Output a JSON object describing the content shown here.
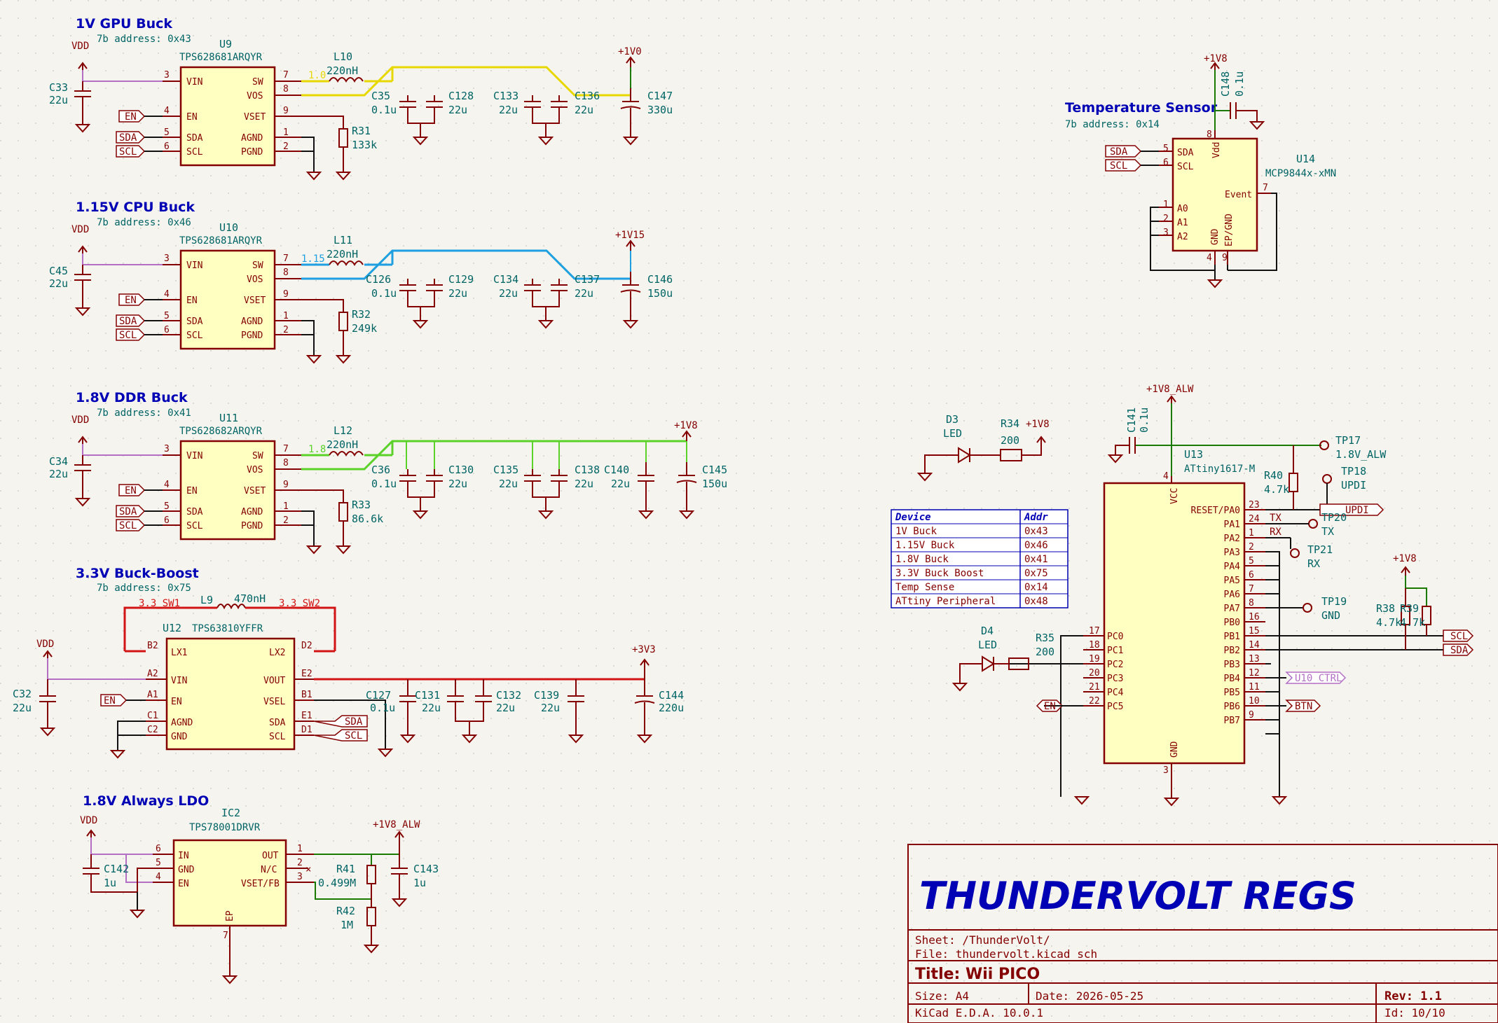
{
  "sections": {
    "gpu": {
      "title": "1V GPU Buck",
      "addr": "7b address: 0x43",
      "ic_ref": "U9",
      "ic_part": "TPS628681ARQYR",
      "inductor": "L10",
      "inductor_val": "220nH",
      "out_rail": "+1V0",
      "vsw_label": "1.0"
    },
    "cpu": {
      "title": "1.15V CPU Buck",
      "addr": "7b address: 0x46",
      "ic_ref": "U10",
      "ic_part": "TPS628681ARQYR",
      "inductor": "L11",
      "inductor_val": "220nH",
      "out_rail": "+1V15",
      "vsw_label": "1.15"
    },
    "ddr": {
      "title": "1.8V DDR Buck",
      "addr": "7b address: 0x41",
      "ic_ref": "U11",
      "ic_part": "TPS628682ARQYR",
      "inductor": "L12",
      "inductor_val": "220nH",
      "out_rail": "+1V8",
      "vsw_label": "1.8"
    },
    "bb": {
      "title": "3.3V Buck-Boost",
      "addr": "7b address: 0x75",
      "ic_ref": "U12",
      "ic_part": "TPS63810YFFR",
      "inductor": "L9",
      "inductor_val": "470nH",
      "sw1": "3.3_SW1",
      "sw2": "3.3_SW2",
      "out_rail": "+3V3"
    },
    "ldo": {
      "title": "1.8V Always LDO",
      "ic_ref": "IC2",
      "ic_part": "TPS78001DRVR",
      "out_rail": "+1V8_ALW"
    },
    "temp": {
      "title": "Temperature Sensor",
      "addr": "7b address: 0x14",
      "ic_ref": "U14",
      "ic_part": "MCP9844x-xMN",
      "rail": "+1V8"
    },
    "mcu": {
      "ic_ref": "U13",
      "ic_part": "ATtiny1617-M",
      "rail": "+1V8_ALW"
    }
  },
  "common": {
    "vdd": "VDD",
    "en": "EN",
    "sda": "SDA",
    "scl": "SCL"
  },
  "pins_buck": {
    "vin": "VIN",
    "en": "EN",
    "sda": "SDA",
    "scl": "SCL",
    "sw": "SW",
    "vos": "VOS",
    "vset": "VSET",
    "agnd": "AGND",
    "pgnd": "PGND"
  },
  "caps": {
    "C33": {
      "ref": "C33",
      "val": "22u"
    },
    "C35": {
      "ref": "C35",
      "val": "0.1u"
    },
    "C128": {
      "ref": "C128",
      "val": "22u"
    },
    "C133": {
      "ref": "C133",
      "val": "22u"
    },
    "C136": {
      "ref": "C136",
      "val": "22u"
    },
    "C147": {
      "ref": "C147",
      "val": "330u"
    },
    "C45": {
      "ref": "C45",
      "val": "22u"
    },
    "C126": {
      "ref": "C126",
      "val": "0.1u"
    },
    "C129": {
      "ref": "C129",
      "val": "22u"
    },
    "C134": {
      "ref": "C134",
      "val": "22u"
    },
    "C137": {
      "ref": "C137",
      "val": "22u"
    },
    "C146": {
      "ref": "C146",
      "val": "150u"
    },
    "C34": {
      "ref": "C34",
      "val": "22u"
    },
    "C36": {
      "ref": "C36",
      "val": "0.1u"
    },
    "C130": {
      "ref": "C130",
      "val": "22u"
    },
    "C135": {
      "ref": "C135",
      "val": "22u"
    },
    "C138": {
      "ref": "C138",
      "val": "22u"
    },
    "C140": {
      "ref": "C140",
      "val": "22u"
    },
    "C145": {
      "ref": "C145",
      "val": "150u"
    },
    "C32": {
      "ref": "C32",
      "val": "22u"
    },
    "C127": {
      "ref": "C127",
      "val": "0.1u"
    },
    "C131": {
      "ref": "C131",
      "val": "22u"
    },
    "C132": {
      "ref": "C132",
      "val": "22u"
    },
    "C139": {
      "ref": "C139",
      "val": "22u"
    },
    "C144": {
      "ref": "C144",
      "val": "220u"
    },
    "C142": {
      "ref": "C142",
      "val": "1u"
    },
    "C143": {
      "ref": "C143",
      "val": "1u"
    },
    "C148": {
      "ref": "C148",
      "val": "0.1u"
    },
    "C141": {
      "ref": "C141",
      "val": "0.1u"
    }
  },
  "res": {
    "R31": {
      "ref": "R31",
      "val": "133k"
    },
    "R32": {
      "ref": "R32",
      "val": "249k"
    },
    "R33": {
      "ref": "R33",
      "val": "86.6k"
    },
    "R41": {
      "ref": "R41",
      "val": "0.499M"
    },
    "R42": {
      "ref": "R42",
      "val": "1M"
    },
    "R34": {
      "ref": "R34",
      "val": "200"
    },
    "R35": {
      "ref": "R35",
      "val": "200"
    },
    "R40": {
      "ref": "R40",
      "val": "4.7k"
    },
    "R38": {
      "ref": "R38",
      "val": "4.7k"
    },
    "R39": {
      "ref": "R39",
      "val": "4.7k"
    }
  },
  "leds": {
    "D3": {
      "ref": "D3",
      "val": "LED"
    },
    "D4": {
      "ref": "D4",
      "val": "LED"
    }
  },
  "testpoints": {
    "TP17": {
      "ref": "TP17",
      "net": "1.8V_ALW"
    },
    "TP18": {
      "ref": "TP18",
      "net": "UPDI"
    },
    "TP20": {
      "ref": "TP20",
      "net": "TX"
    },
    "TP21": {
      "ref": "TP21",
      "net": "RX"
    },
    "TP19": {
      "ref": "TP19",
      "net": "GND"
    }
  },
  "bb_pins": {
    "b2": "B2",
    "lx1": "LX1",
    "lx2": "LX2",
    "d2": "D2",
    "a2": "A2",
    "vin": "VIN",
    "a1": "A1",
    "en": "EN",
    "c1": "C1",
    "agnd": "AGND",
    "c2": "C2",
    "gnd": "GND",
    "e2": "E2",
    "vout": "VOUT",
    "b1": "B1",
    "vsel": "VSEL",
    "e1": "E1",
    "sda": "SDA",
    "d1": "D1",
    "scl": "SCL"
  },
  "ldo_pins": {
    "in": "IN",
    "gnd": "GND",
    "en": "EN",
    "out": "OUT",
    "nc": "N/C",
    "vset": "VSET/FB",
    "ep": "EP",
    "p6": "6",
    "p5": "5",
    "p4": "4",
    "p1": "1",
    "p2": "2",
    "p3": "3",
    "p7": "7"
  },
  "temp_pins": {
    "sda": "SDA",
    "scl": "SCL",
    "a0": "A0",
    "a1": "A1",
    "a2": "A2",
    "vdd": "Vdd",
    "event": "Event",
    "gnd": "GND",
    "epgnd": "EP/GND",
    "p5": "5",
    "p6": "6",
    "p1": "1",
    "p2": "2",
    "p3": "3",
    "p8": "8",
    "p7": "7",
    "p4": "4",
    "p9": "9"
  },
  "mcu_pins": {
    "vcc": "VCC",
    "gnd": "GND",
    "p4": "4",
    "p3": "3",
    "right": [
      {
        "num": "23",
        "name": "RESET/PA0"
      },
      {
        "num": "24",
        "name": "PA1"
      },
      {
        "num": "1",
        "name": "PA2"
      },
      {
        "num": "2",
        "name": "PA3"
      },
      {
        "num": "5",
        "name": "PA4"
      },
      {
        "num": "6",
        "name": "PA5"
      },
      {
        "num": "7",
        "name": "PA6"
      },
      {
        "num": "8",
        "name": "PA7"
      },
      {
        "num": "16",
        "name": "PB0"
      },
      {
        "num": "15",
        "name": "PB1"
      },
      {
        "num": "14",
        "name": "PB2"
      },
      {
        "num": "13",
        "name": "PB3"
      },
      {
        "num": "12",
        "name": "PB4"
      },
      {
        "num": "11",
        "name": "PB5"
      },
      {
        "num": "10",
        "name": "PB6"
      },
      {
        "num": "9",
        "name": "PB7"
      }
    ],
    "left": [
      {
        "num": "17",
        "name": "PC0"
      },
      {
        "num": "18",
        "name": "PC1"
      },
      {
        "num": "19",
        "name": "PC2"
      },
      {
        "num": "20",
        "name": "PC3"
      },
      {
        "num": "21",
        "name": "PC4"
      },
      {
        "num": "22",
        "name": "PC5"
      }
    ]
  },
  "mcu_nets": {
    "tx": "TX",
    "rx": "RX",
    "updi": "UPDI",
    "scl": "SCL",
    "sda": "SDA",
    "u10_ctrl": "U10_CTRL",
    "btn": "BTN",
    "en": "EN"
  },
  "addr_table": {
    "headers": [
      "Device",
      "Addr"
    ],
    "rows": [
      [
        "1V Buck",
        "0x43"
      ],
      [
        "1.15V Buck",
        "0x46"
      ],
      [
        "1.8V Buck",
        "0x41"
      ],
      [
        "3.3V Buck Boost",
        "0x75"
      ],
      [
        "Temp Sense",
        "0x14"
      ],
      [
        "ATtiny Peripheral",
        "0x48"
      ]
    ]
  },
  "title_block": {
    "project": "THUNDERVOLT REGS",
    "sheet": "Sheet: /ThunderVolt/",
    "file": "File: thundervolt.kicad_sch",
    "title": "Title: Wii PICO",
    "size": "Size: A4",
    "date": "Date: 2026-05-25",
    "rev": "Rev: 1.1",
    "tool": "KiCad E.D.A. 10.0.1",
    "id": "Id: 10/10"
  },
  "colors": {
    "yellow_rail": "#e6d800",
    "blue_rail": "#1ea0e0",
    "green_rail": "#5ad22a",
    "red_rail": "#d21414"
  }
}
